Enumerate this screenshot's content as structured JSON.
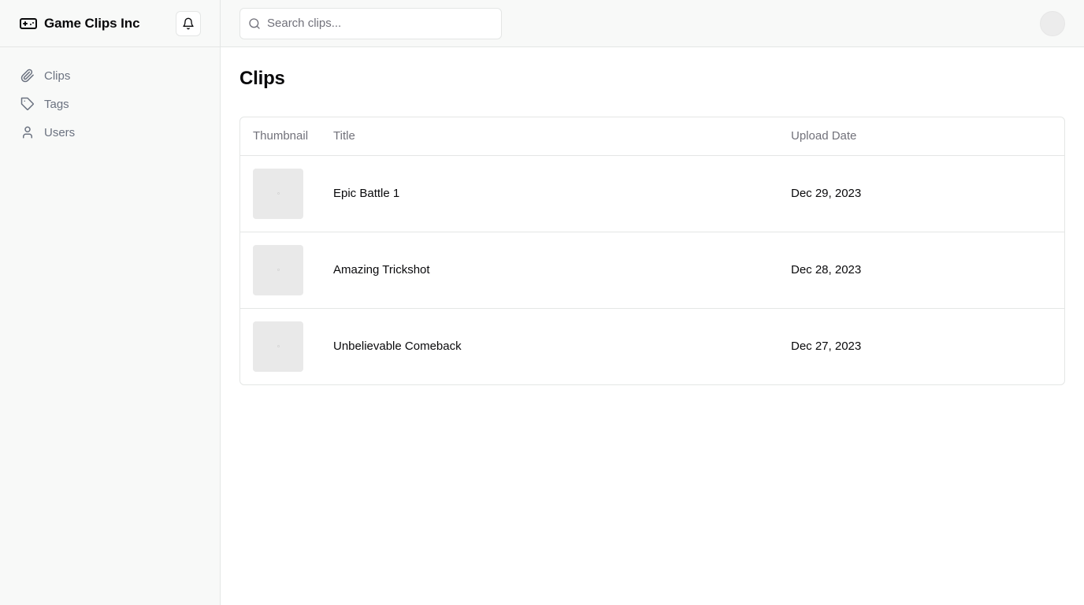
{
  "brand": {
    "name": "Game Clips Inc",
    "icon": "gamepad-icon"
  },
  "notifications": {
    "icon": "bell-icon"
  },
  "sidebar": {
    "items": [
      {
        "label": "Clips",
        "icon": "paperclip-icon"
      },
      {
        "label": "Tags",
        "icon": "tag-icon"
      },
      {
        "label": "Users",
        "icon": "user-icon"
      }
    ]
  },
  "search": {
    "placeholder": "Search clips...",
    "value": "",
    "icon": "search-icon"
  },
  "page": {
    "title": "Clips"
  },
  "table": {
    "headers": {
      "thumbnail": "Thumbnail",
      "title": "Title",
      "upload_date": "Upload Date"
    },
    "rows": [
      {
        "title": "Epic Battle 1",
        "date": "Dec 29, 2023"
      },
      {
        "title": "Amazing Trickshot",
        "date": "Dec 28, 2023"
      },
      {
        "title": "Unbelievable Comeback",
        "date": "Dec 27, 2023"
      }
    ]
  },
  "colors": {
    "sidebar_bg": "#f8f9f8",
    "border": "#e4e6e5",
    "muted_text": "#6b7280",
    "thumbnail_bg": "#e9e9e9"
  }
}
